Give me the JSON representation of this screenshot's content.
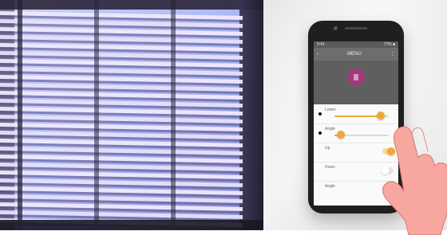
{
  "scene": {
    "left_panel": "window-with-venetian-blinds",
    "right_panel": "smartphone-app-control",
    "accent_color": "#f0a83b",
    "brand_color": "#a13a78"
  },
  "phone": {
    "status": {
      "left": "9:41",
      "right": "77% ■"
    },
    "appbar": {
      "left": "‹",
      "center": "MENU",
      "right": "⋮"
    },
    "app_icon_caption": "",
    "controls": [
      {
        "label": "Lower",
        "type": "slider",
        "value": 0.85
      },
      {
        "label": "Angle",
        "type": "slider",
        "value": 0.12
      },
      {
        "label": "Up",
        "type": "toggle",
        "state": "on"
      },
      {
        "label": "Down",
        "type": "toggle",
        "state": "off"
      },
      {
        "label": "Angle",
        "type": "toggle",
        "state": "on"
      }
    ]
  }
}
